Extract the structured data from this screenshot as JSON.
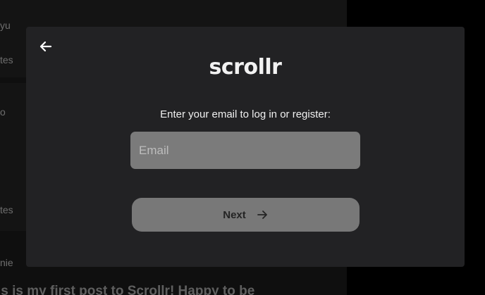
{
  "background_feed": {
    "snippets": [
      "yu",
      "tes",
      "o",
      "tes",
      "nie"
    ],
    "post_preview": "is is my first post to Scrollr! Happy to be"
  },
  "modal": {
    "logo": "scrollr",
    "prompt": "Enter your email to log in or register:",
    "email_placeholder": "Email",
    "email_value": "",
    "next_label": "Next"
  },
  "icons": {
    "back": "arrow-left-icon",
    "next": "arrow-right-icon"
  },
  "colors": {
    "page_bg": "#000000",
    "modal_bg": "#222224",
    "input_bg": "#7b7b7b",
    "button_bg": "#787878"
  }
}
